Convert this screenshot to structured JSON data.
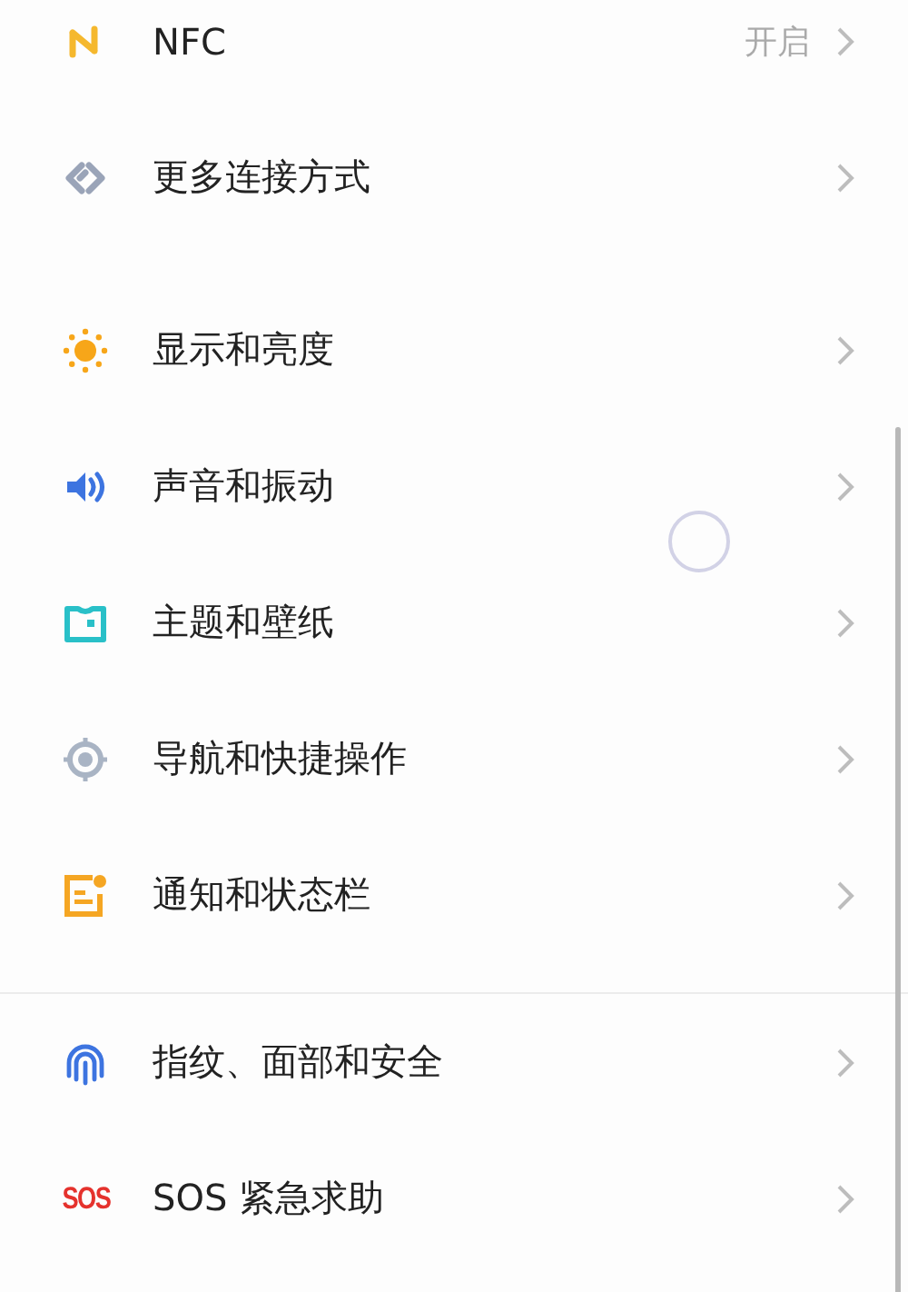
{
  "groups": [
    {
      "divider": false,
      "items": [
        {
          "label": "NFC",
          "value": "开启"
        },
        {
          "label": "更多连接方式"
        }
      ]
    },
    {
      "divider": false,
      "items": [
        {
          "label": "显示和亮度"
        },
        {
          "label": "声音和振动"
        },
        {
          "label": "主题和壁纸"
        },
        {
          "label": "导航和快捷操作"
        },
        {
          "label": "通知和状态栏"
        }
      ]
    },
    {
      "divider": true,
      "items": [
        {
          "label": "指纹、面部和安全"
        },
        {
          "label": "SOS 紧急求助",
          "icon_text": "SOS"
        }
      ]
    }
  ]
}
